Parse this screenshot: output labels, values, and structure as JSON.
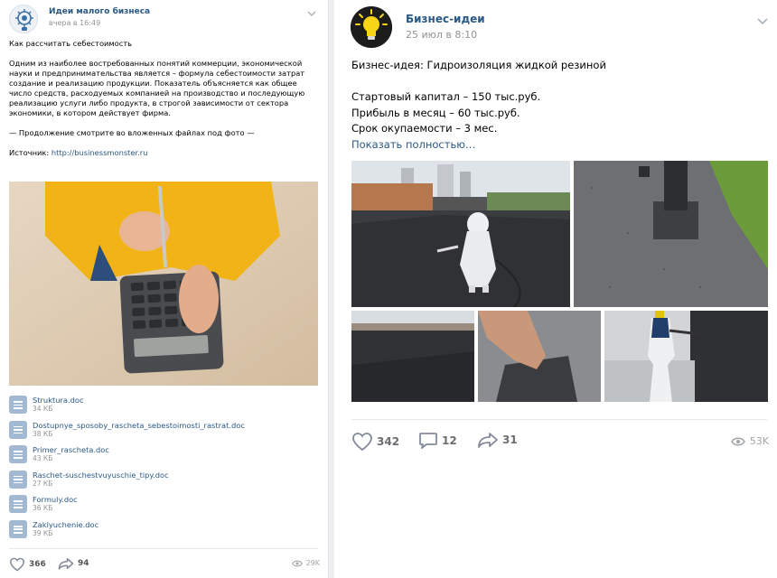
{
  "left_post": {
    "group_name": "Идеи малого бизнеса",
    "date": "вчера в 16:49",
    "title": "Как рассчитать себестоимость",
    "paragraph": "Одним из наиболее востребованных понятий коммерции, экономической науки и предпринимательства является – формула себестоимости затрат создание и реализацию продукции. Показатель объясняется как общее число средств, расходуемых компанией на производство и последующую реализацию услуги либо продукта, в строгой зависимости от сектора экономики, в котором действует фирма.",
    "continuation": "— Продолжение смотрите во вложенных файлах под фото —",
    "source_label": "Источник:",
    "source_link": "http://businessmonster.ru",
    "docs": [
      {
        "name": "Struktura.doc",
        "size": "34 КБ"
      },
      {
        "name": "Dostupnye_sposoby_rascheta_sebestoimosti_rastrat.doc",
        "size": "38 КБ"
      },
      {
        "name": "Primer_rascheta.doc",
        "size": "43 КБ"
      },
      {
        "name": "Raschet-suschestvuyuschie_tipy.doc",
        "size": "27 КБ"
      },
      {
        "name": "Formuly.doc",
        "size": "36 КБ"
      },
      {
        "name": "Zaklyuchenie.doc",
        "size": "39 КБ"
      }
    ],
    "likes": "366",
    "shares": "94",
    "views": "29K",
    "link_color": "#2a5885",
    "doc_icon_color": "#a3b9d2"
  },
  "right_post": {
    "group_name": "Бизнес-идеи",
    "date": "25 июл в 8:10",
    "headline": "Бизнес-идея: Гидроизоляция жидкой резиной",
    "line1": "Стартовый капитал – 150 тыс.руб.",
    "line2": "Прибыль в месяц – 60 тыс.руб.",
    "line3": "Срок окупаемости – 3 мес.",
    "show_more": "Показать полностью…",
    "likes": "342",
    "comments": "12",
    "shares": "31",
    "views": "53K",
    "avatar_bulb_color": "#f7d415"
  },
  "icons": {
    "like": "heart-icon",
    "comment": "comment-icon",
    "share": "share-arrow-icon",
    "views": "eye-icon",
    "menu": "chevron-down-icon",
    "document": "document-icon"
  }
}
